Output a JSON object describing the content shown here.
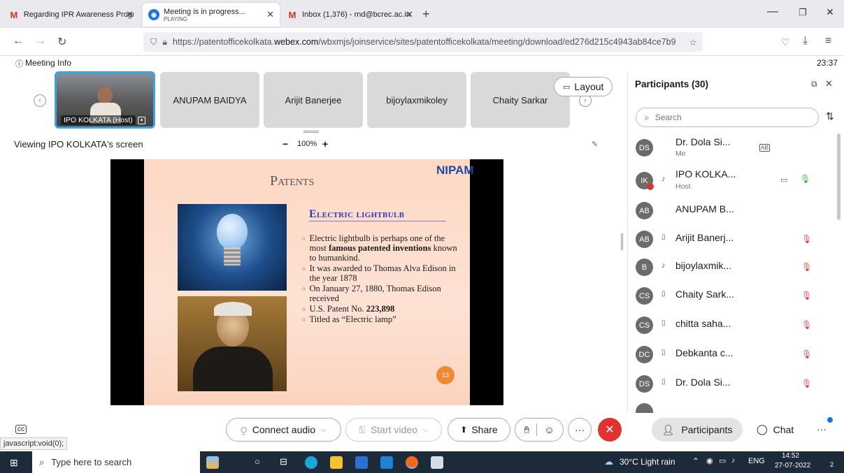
{
  "browser": {
    "tabs": [
      {
        "title": "Regarding IPR Awareness Progr",
        "icon": "gmail-icon",
        "active": false
      },
      {
        "title": "Meeting is in progress...",
        "subtitle": "PLAYING",
        "icon": "webex-icon",
        "active": true
      },
      {
        "title": "Inbox (1,376) - rnd@bcrec.ac.in",
        "icon": "gmail-icon",
        "active": false
      }
    ],
    "url_prefix": "https://patentofficekolkata.",
    "url_host": "webex.com",
    "url_path": "/wbxmjs/joinservice/sites/patentofficekolkata/meeting/download/ed276d215c4943ab84ce7b9"
  },
  "meeting": {
    "info_label": "Meeting Info",
    "timer": "23:37",
    "self_video_label": "IPO KOLKATA (Host)",
    "video_tiles": [
      "ANUPAM BAIDYA",
      "Arijit Banerjee",
      "bijoylaxmikoley",
      "Chaity Sarkar"
    ],
    "layout_label": "Layout",
    "viewing_label": "Viewing IPO KOLKATA's screen",
    "zoom_minus": "−",
    "zoom_level": "100%",
    "zoom_plus": "+"
  },
  "slide": {
    "logo": "NIPAM",
    "title": "Patents",
    "heading": "Electric lightbulb",
    "bullets": [
      {
        "pre": "Electric lightbulb is perhaps one of the most ",
        "bold": "famous patented inventions",
        "post": " known to humankind."
      },
      {
        "pre": "It was awarded to Thomas Alva Edison in the year 1878",
        "bold": "",
        "post": ""
      },
      {
        "pre": "On January 27, 1880, Thomas Edison received",
        "bold": "",
        "post": ""
      },
      {
        "pre": "U.S. Patent No. ",
        "bold": "223,898",
        "post": ""
      },
      {
        "pre": "Titled as “Electric lamp”",
        "bold": "",
        "post": ""
      }
    ],
    "page_number": "13"
  },
  "participants_panel": {
    "title": "Participants (30)",
    "search_placeholder": "Search",
    "list": [
      {
        "initials": "DS",
        "name": "Dr. Dola Si...",
        "role": "Me",
        "muted": false
      },
      {
        "initials": "IK",
        "name": "IPO KOLKA...",
        "role": "Host",
        "muted": false
      },
      {
        "initials": "AB",
        "name": "ANUPAM B...",
        "role": "",
        "muted": false
      },
      {
        "initials": "AB",
        "name": "Arijit Banerj...",
        "role": "",
        "muted": true
      },
      {
        "initials": "B",
        "name": "bijoylaxmik...",
        "role": "",
        "muted": true
      },
      {
        "initials": "CS",
        "name": "Chaity Sark...",
        "role": "",
        "muted": true
      },
      {
        "initials": "CS",
        "name": "chitta saha...",
        "role": "",
        "muted": true
      },
      {
        "initials": "DC",
        "name": "Debkanta c...",
        "role": "",
        "muted": true
      },
      {
        "initials": "DS",
        "name": "Dr. Dola Si...",
        "role": "",
        "muted": true
      }
    ]
  },
  "controls": {
    "connect_audio": "Connect audio",
    "start_video": "Start video",
    "share": "Share",
    "more": "···",
    "participants": "Participants",
    "chat": "Chat"
  },
  "status_text": "javascript:void(0);",
  "taskbar": {
    "search_placeholder": "Type here to search",
    "weather": "30°C  Light rain",
    "lang": "ENG",
    "time": "14:52",
    "date": "27-07-2022",
    "notifications": "2"
  },
  "colors": {
    "accent_blue": "#3fa3e0",
    "end_call_red": "#e0322f",
    "slide_heading_blue": "#2a3bbd",
    "bullet_orange": "#e07a2a"
  }
}
